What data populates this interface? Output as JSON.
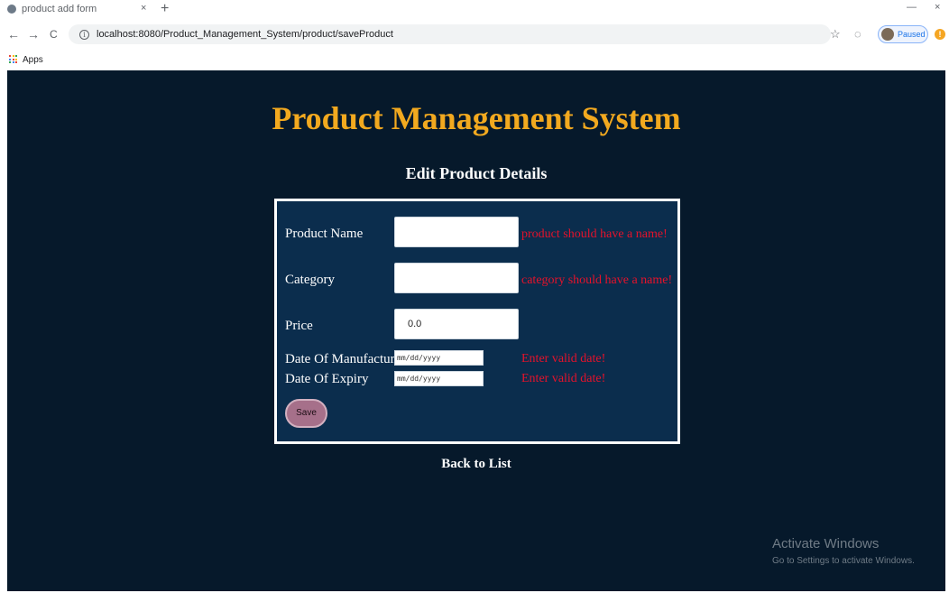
{
  "browser": {
    "tab_title": "product add form",
    "tab_close": "×",
    "new_tab": "+",
    "window_minimize": "—",
    "window_close": "×",
    "back": "←",
    "forward": "→",
    "reload": "C",
    "url": "localhost:8080/Product_Management_System/product/saveProduct",
    "star": "☆",
    "extension": "◌",
    "profile_label": "Paused",
    "menu": "!",
    "bookmarks_apps": "Apps"
  },
  "page": {
    "title": "Product Management System",
    "subtitle": "Edit Product Details",
    "back_link": "Back to List"
  },
  "form": {
    "product_name": {
      "label": "Product Name",
      "value": "",
      "error": "product should have a name!"
    },
    "category": {
      "label": "Category",
      "value": "",
      "error": "category should have a name!"
    },
    "price": {
      "label": "Price",
      "value": "0.0"
    },
    "date_of_manufacture": {
      "label": "Date Of Manufacture",
      "placeholder": "mm/dd/yyyy",
      "error": "Enter valid date!"
    },
    "date_of_expiry": {
      "label": "Date Of Expiry",
      "placeholder": "mm/dd/yyyy",
      "error": "Enter valid date!"
    },
    "save_label": "Save"
  },
  "windows_watermark": {
    "title": "Activate Windows",
    "subtitle": "Go to Settings to activate Windows."
  },
  "colors": {
    "page_background": "#06192b",
    "form_background": "#0b2d4d",
    "title": "#f2a91f",
    "error": "#e5122b",
    "save_button": "#a6708a"
  }
}
